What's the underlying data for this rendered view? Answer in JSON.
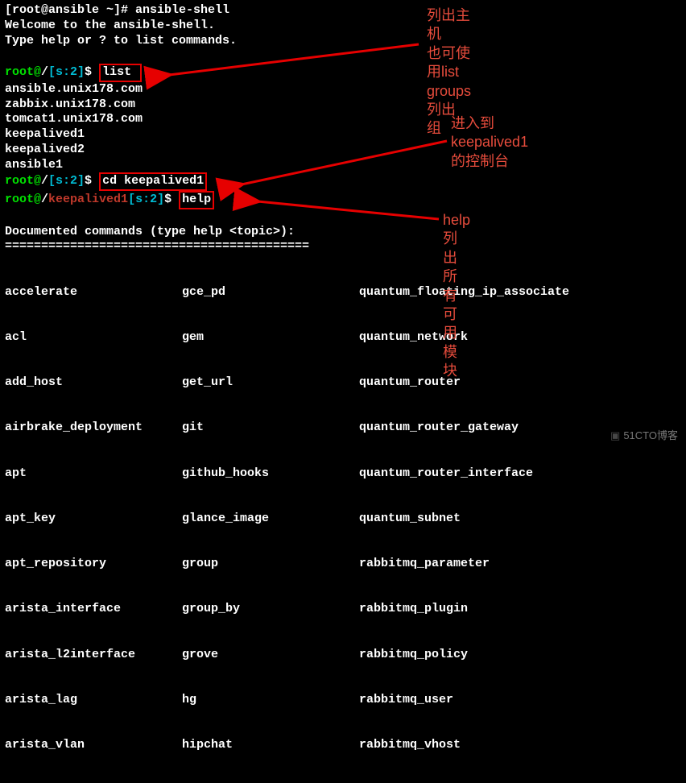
{
  "header": {
    "prompt": "[root@ansible ~]# ",
    "command": "ansible-shell",
    "welcome1": "Welcome to the ansible-shell.",
    "welcome2": "Type help or ? to list commands."
  },
  "prompt1": {
    "user": "root@",
    "path": "/",
    "sig": "[s:2]",
    "dollar": "$ ",
    "cmd": "list"
  },
  "hosts": [
    "ansible.unix178.com",
    "zabbix.unix178.com",
    "tomcat1.unix178.com",
    "keepalived1",
    "keepalived2",
    "ansible1"
  ],
  "prompt2": {
    "user": "root@",
    "path": "/",
    "sig": "[s:2]",
    "dollar": "$ ",
    "cmd": "cd keepalived1"
  },
  "prompt3": {
    "user": "root@",
    "path": "/",
    "kp": "keepalived1",
    "sig": "[s:2]",
    "dollar": "$ ",
    "cmd": "help"
  },
  "doc": {
    "header": "Documented commands (type help <topic>):",
    "divider": "=========================================="
  },
  "cols": {
    "c1": [
      "accelerate",
      "acl",
      "add_host",
      "airbrake_deployment",
      "apt",
      "apt_key",
      "apt_repository",
      "arista_interface",
      "arista_l2interface",
      "arista_lag",
      "arista_vlan"
    ],
    "c2": [
      "gce_pd",
      "gem",
      "get_url",
      "git",
      "github_hooks",
      "glance_image",
      "group",
      "group_by",
      "grove",
      "hg",
      "hipchat"
    ],
    "c3": [
      "quantum_floating_ip_associate",
      "quantum_network",
      "quantum_router",
      "quantum_router_gateway",
      "quantum_router_interface",
      "quantum_subnet",
      "rabbitmq_parameter",
      "rabbitmq_plugin",
      "rabbitmq_policy",
      "rabbitmq_user",
      "rabbitmq_vhost"
    ]
  },
  "annos": {
    "a1_l1": "列出主机",
    "a1_l2": "也可使用list groups列出",
    "a1_l3": "组",
    "a2_l1": "进入到keepalived1",
    "a2_l2": "的控制台",
    "a3": "help列出所有可用模块"
  },
  "watermark": "51CTO博客"
}
